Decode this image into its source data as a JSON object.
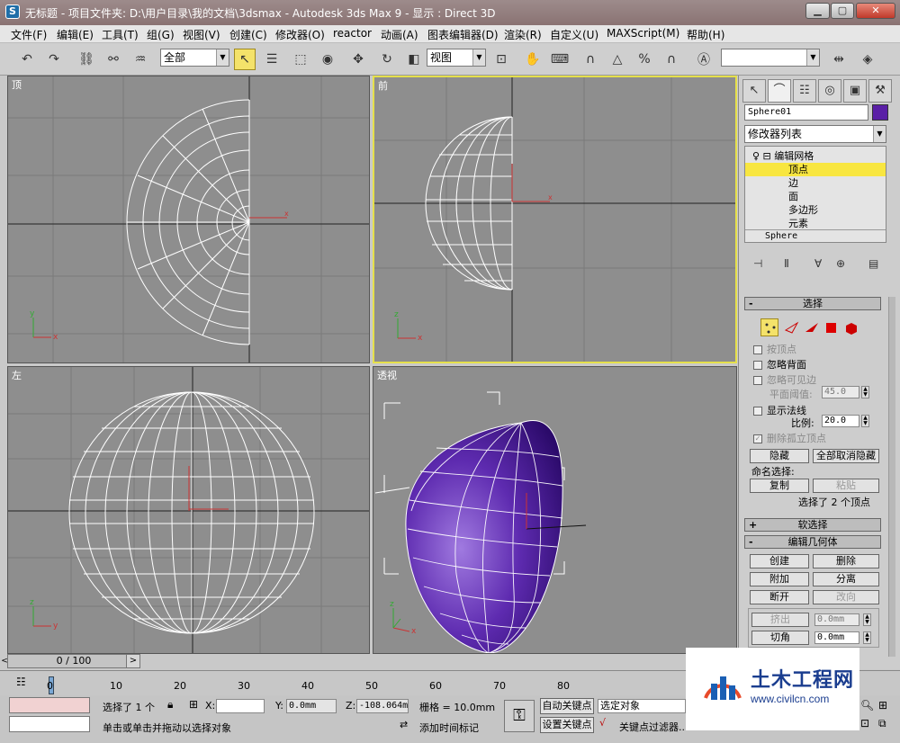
{
  "titlebar": {
    "title": "无标题     - 项目文件夹: D:\\用户目录\\我的文档\\3dsmax     - Autodesk 3ds Max 9     - 显示 : Direct 3D",
    "minimize": "▁",
    "maximize": "▢",
    "close": "✕"
  },
  "menu": [
    "文件(F)",
    "编辑(E)",
    "工具(T)",
    "组(G)",
    "视图(V)",
    "创建(C)",
    "修改器(O)",
    "reactor",
    "动画(A)",
    "图表编辑器(D)",
    "渲染(R)",
    "自定义(U)",
    "MAXScript(M)",
    "帮助(H)"
  ],
  "toolbar": {
    "selection_filter": "全部",
    "ref_coord": "视图",
    "named_selection": ""
  },
  "viewports": {
    "top": "顶",
    "front": "前",
    "left": "左",
    "perspective": "透视"
  },
  "command_panel": {
    "object_name": "Sphere01",
    "object_color": "#5a1fa6",
    "modifier_list": "修改器列表",
    "stack": {
      "modifier": "编辑网格",
      "sub_vertex": "顶点",
      "sub_edge": "边",
      "sub_face": "面",
      "sub_polygon": "多边形",
      "sub_element": "元素",
      "base": "Sphere"
    },
    "selection": {
      "title": "选择",
      "by_vertex": "按顶点",
      "ignore_backface": "忽略背面",
      "ignore_visible_edges": "忽略可见边",
      "planar_threshold_label": "平面阈值:",
      "planar_threshold": "45.0",
      "show_normals": "显示法线",
      "scale_label": "比例:",
      "scale": "20.0",
      "delete_isolated": "删除孤立顶点",
      "hide": "隐藏",
      "unhide_all": "全部取消隐藏",
      "named_selections": "命名选择:",
      "copy": "复制",
      "paste": "粘贴",
      "status": "选择了 2 个顶点"
    },
    "soft_selection": "软选择",
    "edit_geometry": {
      "title": "编辑几何体",
      "create": "创建",
      "delete": "删除",
      "attach": "附加",
      "detach": "分离",
      "break": "断开",
      "turn": "改向",
      "extrude": "挤出",
      "extrude_val": "0.0mm",
      "chamfer": "切角",
      "chamfer_val": "0.0mm"
    }
  },
  "timeline": {
    "frame": "0 / 100",
    "ticks": [
      "0",
      "10",
      "20",
      "30",
      "40",
      "50",
      "60",
      "70",
      "80"
    ]
  },
  "status": {
    "selected": "选择了 1 个",
    "x_label": "X:",
    "x_val": "",
    "y_label": "Y:",
    "y_val": "0.0mm",
    "z_label": "Z:",
    "z_val": "-108.064m",
    "grid": "栅格 = 10.0mm",
    "auto_key": "自动关键点",
    "selected_object": "选定对象",
    "set_key": "设置关键点",
    "key_filters": "关键点过滤器...",
    "prompt": "单击或单击并拖动以选择对象",
    "add_time_tag": "添加时间标记"
  },
  "watermark": {
    "title": "土木工程网",
    "url": "www.civilcn.com"
  }
}
